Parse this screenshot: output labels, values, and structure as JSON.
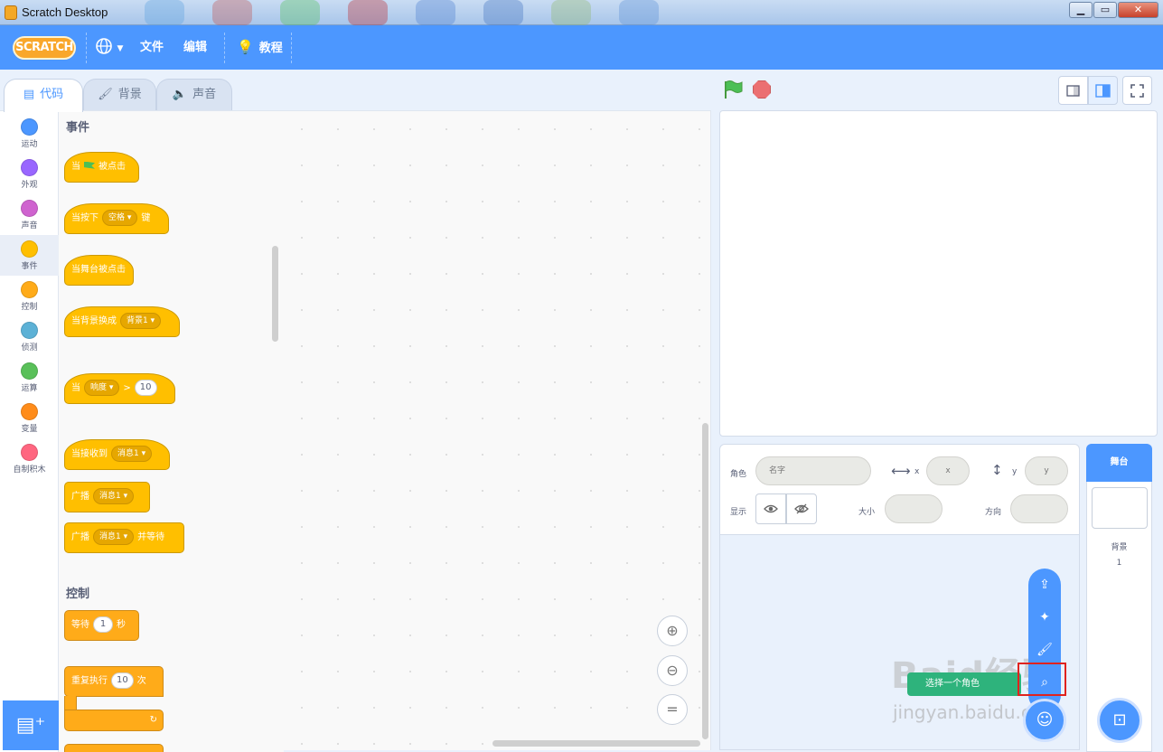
{
  "window": {
    "title": "Scratch Desktop",
    "minimize": "▁",
    "maximize": "▭",
    "close": "✕"
  },
  "menubar": {
    "logo": "SCRATCH",
    "language_icon": "globe-icon",
    "file": "文件",
    "edit": "编辑",
    "tutorials": "教程"
  },
  "tabs": {
    "code": "代码",
    "costumes": "背景",
    "sounds": "声音"
  },
  "categories": [
    {
      "label": "运动",
      "color": "#4c97ff"
    },
    {
      "label": "外观",
      "color": "#9966ff"
    },
    {
      "label": "声音",
      "color": "#cf63cf"
    },
    {
      "label": "事件",
      "color": "#ffbf00"
    },
    {
      "label": "控制",
      "color": "#ffab19"
    },
    {
      "label": "侦测",
      "color": "#5cb1d6"
    },
    {
      "label": "运算",
      "color": "#59c059"
    },
    {
      "label": "变量",
      "color": "#ff8c1a"
    },
    {
      "label": "自制积木",
      "color": "#ff6680"
    }
  ],
  "palette": {
    "events_title": "事件",
    "control_title": "控制",
    "when_flag": {
      "pre": "当",
      "post": "被点击"
    },
    "when_key": {
      "pre": "当按下",
      "key": "空格",
      "post": "键"
    },
    "when_stage": "当舞台被点击",
    "when_backdrop": {
      "pre": "当背景换成",
      "value": "背景1"
    },
    "when_loudness": {
      "pre": "当",
      "sensor": "响度",
      "op": ">",
      "value": "10"
    },
    "when_receive": {
      "pre": "当接收到",
      "value": "消息1"
    },
    "broadcast": {
      "pre": "广播",
      "value": "消息1"
    },
    "broadcast_wait": {
      "pre": "广播",
      "value": "消息1",
      "post": "并等待"
    },
    "wait": {
      "pre": "等待",
      "value": "1",
      "post": "秒"
    },
    "repeat": {
      "pre": "重复执行",
      "value": "10",
      "post": "次"
    },
    "repeat_arrow": "↻"
  },
  "zoom": {
    "in": "⊕",
    "out": "⊖",
    "reset": "="
  },
  "sprite_info": {
    "sprite_label": "角色",
    "name_placeholder": "名字",
    "x_label": "x",
    "x_placeholder": "x",
    "y_label": "y",
    "y_placeholder": "y",
    "show_label": "显示",
    "size_label": "大小",
    "direction_label": "方向",
    "x_arrow": "⟷",
    "y_arrow": "↕"
  },
  "sprite_menu": {
    "upload": "⇪",
    "surprise": "✦",
    "paint": "🖌",
    "choose": "☺"
  },
  "tooltip": "选择一个角色",
  "stage_pane": {
    "header": "舞台",
    "backdrops_label": "背景",
    "backdrops_count": "1",
    "choose_backdrop": "⊡"
  },
  "watermark": {
    "text": "Baid经验",
    "url": "jingyan.baidu.com"
  }
}
